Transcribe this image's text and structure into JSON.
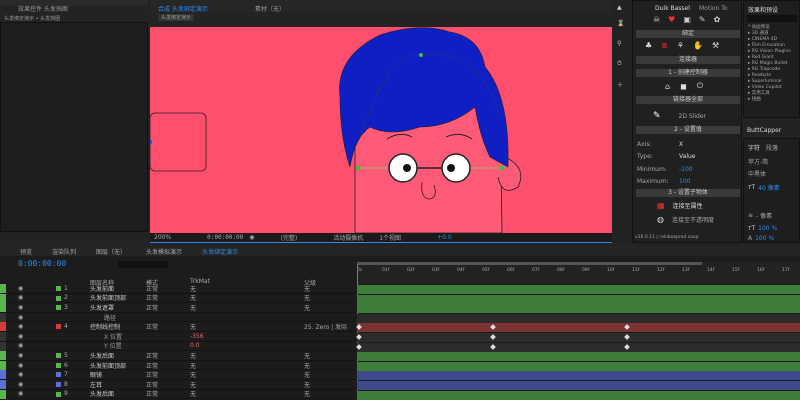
{
  "topbar": {
    "tab1": "效果控件 头发挡图",
    "tab2": "合成 头发绑定演示",
    "tab3": "素材（无）",
    "breadcrumb1": "头发绑定演示 • 头发挡图",
    "breadcrumb2": "头发绑定演示"
  },
  "viewer": {
    "zoom": "200%",
    "time": "0:00:00:00",
    "quality": "(完整)",
    "camera": "活动摄像机",
    "views": "1个视图",
    "exposure": "+0.0"
  },
  "duik": {
    "tab1": "Duik Bassel",
    "tab2": "Motion To",
    "section1": "绑定",
    "linker": "连接器",
    "create_controller": "1 - 创建控制器",
    "connect_all": "链接器全部",
    "slider": "2D Slider",
    "section2": "2 - 设置值",
    "axis_label": "Axis:",
    "axis_value": "X",
    "type_label": "Type:",
    "type_value": "Value",
    "min_label": "Minimum:",
    "min_value": "-100",
    "max_label": "Maximum:",
    "max_value": "100",
    "section3": "3 - 设置子物体",
    "pick_prop": "连接至属性",
    "pick_opacity": "连接至不透明度",
    "version": "v16.0.11 | rainboxprod.coop"
  },
  "effects": {
    "title": "效果和预设",
    "search": "",
    "items": [
      "* 动画预设",
      "▸ 3D 通道",
      "▸ CINEMA 4D",
      "▸ Film Emulation",
      "▸ RG Vision Plugins",
      "▸ Red Giant",
      "▸ RG Magic Bullet",
      "▸ RG Trapcode",
      "▸ Rowbyte",
      "▸ Superluminal",
      "▸ Video Copilot",
      "▸ 实用工具",
      "▸ 扭曲"
    ]
  },
  "buttcapper": {
    "title": "ButtCapper"
  },
  "character": {
    "tab1": "字符",
    "tab2": "段落",
    "font": "苹方-简",
    "style": "中黑体",
    "size": "40 像素",
    "size2": "- 像素",
    "scale": "100 %",
    "scale2": "100 %"
  },
  "lower_tabs": {
    "t1": "预览",
    "t2": "渲染队列",
    "t3": "图层（无）",
    "t4": "头发模拟演示",
    "t5": "头发绑定演示"
  },
  "timeline": {
    "timecode": "0:00:00:00",
    "col_name": "图层名称",
    "col_mode": "模式",
    "col_trkmat": "TrkMat",
    "col_parent": "父级",
    "ruler": [
      "0s",
      "01f",
      "02f",
      "03f",
      "04f",
      "05f",
      "06f",
      "07f",
      "08f",
      "09f",
      "10f",
      "11f",
      "12f",
      "13f",
      "14f",
      "15f",
      "16f",
      "17f"
    ],
    "layers": [
      {
        "num": "1",
        "name": "头发前面",
        "mode": "正常",
        "trk": "无",
        "parent": "无",
        "color": "#5ab54f",
        "bar": "#3f7d3a"
      },
      {
        "num": "2",
        "name": "头发前面顶部",
        "mode": "正常",
        "trk": "无",
        "parent": "无",
        "color": "#5ab54f",
        "bar": "#3f7d3a"
      },
      {
        "num": "3",
        "name": "头发遮罩",
        "mode": "正常",
        "trk": "无",
        "parent": "无",
        "color": "#5ab54f",
        "bar": "#3f7d3a"
      },
      {
        "num": "",
        "name": "路径",
        "mode": "",
        "trk": "",
        "parent": "",
        "color": "",
        "bar": "#2c2c2c"
      },
      {
        "num": "4",
        "name": "控制线控制",
        "mode": "正常",
        "trk": "无",
        "parent": "25. Zero | 发际",
        "color": "#d83a3a",
        "bar": "#7a3232"
      },
      {
        "num": "",
        "name": "X 位置",
        "mode": "",
        "trk": "-356",
        "parent": "",
        "color": "",
        "bar": "#2c2c2c"
      },
      {
        "num": "",
        "name": "Y 位置",
        "mode": "",
        "trk": "0.0",
        "parent": "",
        "color": "",
        "bar": "#2c2c2c"
      },
      {
        "num": "5",
        "name": "头发后面",
        "mode": "正常",
        "trk": "无",
        "parent": "无",
        "color": "#5ab54f",
        "bar": "#3f7d3a"
      },
      {
        "num": "6",
        "name": "头发前面顶部",
        "mode": "正常",
        "trk": "无",
        "parent": "无",
        "color": "#5ab54f",
        "bar": "#3f7d3a"
      },
      {
        "num": "7",
        "name": "眼镜",
        "mode": "正常",
        "trk": "无",
        "parent": "无",
        "color": "#5b6fd4",
        "bar": "#3f4a8c"
      },
      {
        "num": "8",
        "name": "左耳",
        "mode": "正常",
        "trk": "无",
        "parent": "无",
        "color": "#5b6fd4",
        "bar": "#3f4a8c"
      },
      {
        "num": "9",
        "name": "头发后面",
        "mode": "正常",
        "trk": "无",
        "parent": "无",
        "color": "#5ab54f",
        "bar": "#3f7d3a"
      }
    ]
  },
  "colors": {
    "canvas": "#ff4f6c",
    "hair": "#0f1fc4",
    "skin": "#ff5a78",
    "accent": "#2d8ceb"
  }
}
